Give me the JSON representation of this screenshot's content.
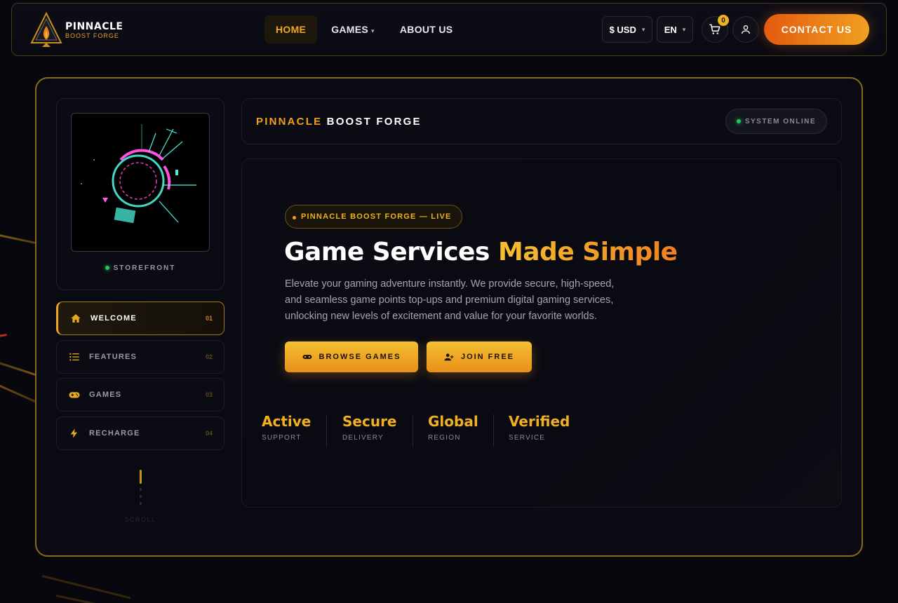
{
  "brand": {
    "name_line1": "PINNACLE",
    "name_line2": "BOOST FORGE"
  },
  "nav": {
    "items": [
      {
        "label": "HOME",
        "active": true
      },
      {
        "label": "GAMES",
        "active": false,
        "dropdown": true
      },
      {
        "label": "ABOUT US",
        "active": false
      }
    ]
  },
  "header": {
    "currency": "$ USD",
    "language": "EN",
    "cart_count": "0",
    "contact_label": "CONTACT US"
  },
  "sidebar": {
    "store_label": "STOREFRONT",
    "items": [
      {
        "label": "WELCOME",
        "num": "01",
        "icon": "home-icon",
        "active": true
      },
      {
        "label": "FEATURES",
        "num": "02",
        "icon": "list-icon",
        "active": false
      },
      {
        "label": "GAMES",
        "num": "03",
        "icon": "gamepad-icon",
        "active": false
      },
      {
        "label": "RECHARGE",
        "num": "04",
        "icon": "bolt-icon",
        "active": false
      }
    ],
    "scroll_label": "SCROLL"
  },
  "title_bar": {
    "title_accent": "PINNACLE",
    "title_rest": "BOOST FORGE",
    "status": "SYSTEM ONLINE"
  },
  "hero": {
    "pill": "PINNACLE BOOST FORGE — LIVE",
    "title_plain": "Game Services ",
    "title_highlight": "Made Simple",
    "description": "Elevate your gaming adventure instantly. We provide secure, high-speed, and seamless game points top-ups and premium digital gaming services, unlocking new levels of excitement and value for your favorite worlds.",
    "browse_label": "BROWSE GAMES",
    "join_label": "JOIN FREE",
    "stats": [
      {
        "value": "Active",
        "label": "SUPPORT"
      },
      {
        "value": "Secure",
        "label": "DELIVERY"
      },
      {
        "value": "Global",
        "label": "REGION"
      },
      {
        "value": "Verified",
        "label": "SERVICE"
      }
    ]
  },
  "colors": {
    "accent": "#f0a81c",
    "accent_orange": "#f08020",
    "online": "#22c55e",
    "background": "#07070d"
  }
}
